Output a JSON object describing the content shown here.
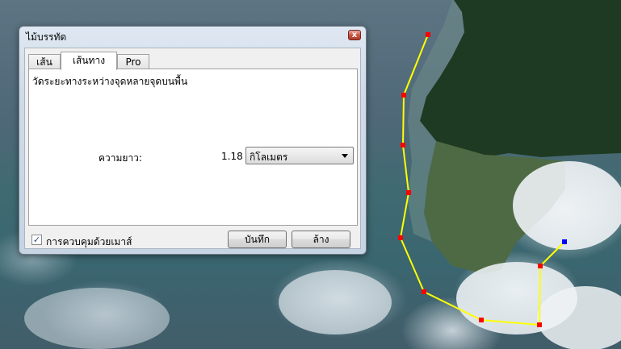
{
  "dialog": {
    "title": "ไม้บรรทัด",
    "close_label": "x",
    "tabs": [
      {
        "label": "เส้น"
      },
      {
        "label": "เส้นทาง",
        "active": true
      },
      {
        "label": "Pro"
      }
    ],
    "description": "วัดระยะทางระหว่างจุดหลายจุดบนพื้น",
    "length_label": "ความยาว:",
    "length_value": "1.18",
    "unit_selected": "กิโลเมตร",
    "mouse_control_label": "การควบคุมด้วยเมาส์",
    "mouse_control_checked": true,
    "check_mark": "✓",
    "save_label": "บันทึก",
    "clear_label": "ล้าง"
  },
  "map": {
    "path_color": "#ffff00",
    "vertex_color": "#ff0000",
    "end_vertex_color": "#0000ff"
  }
}
